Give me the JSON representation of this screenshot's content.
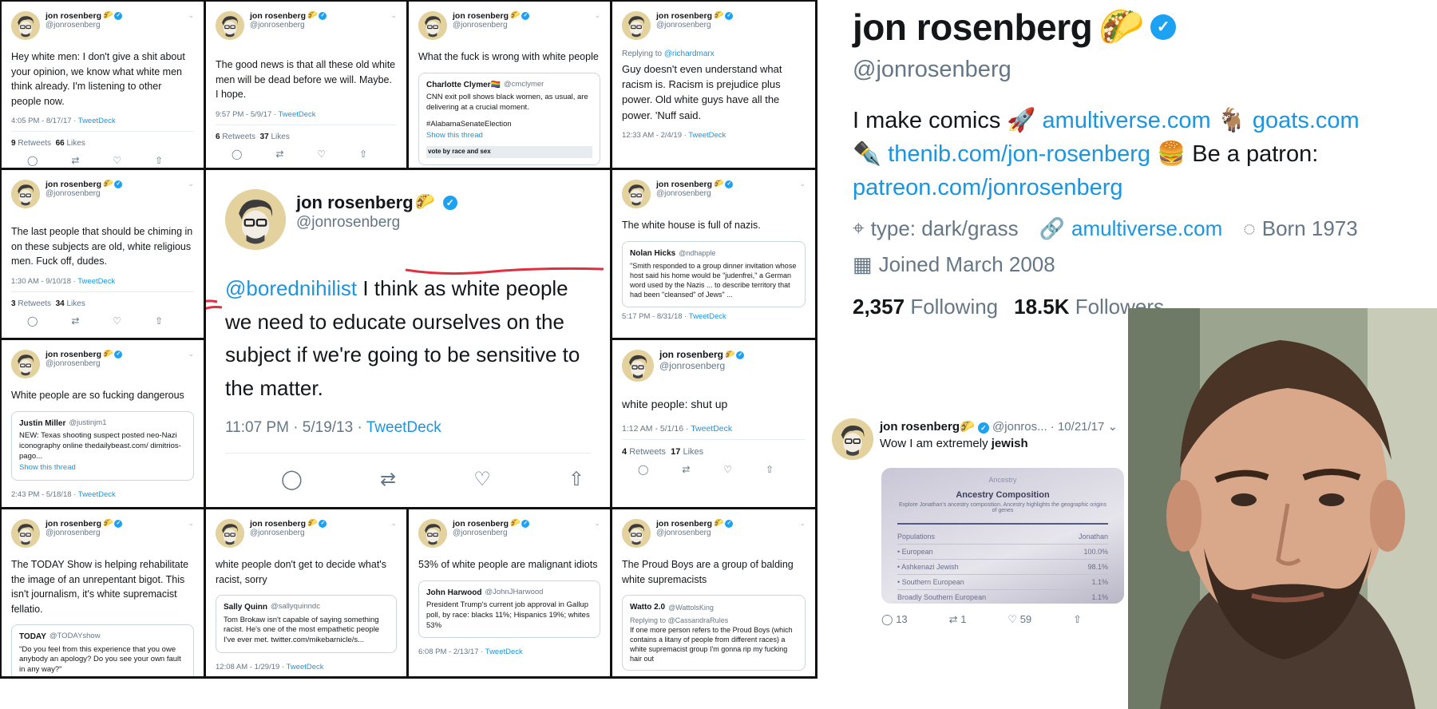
{
  "account": {
    "name": "jon rosenberg",
    "handle": "@jonrosenberg",
    "taco": "🌮",
    "verified_mark": "✓",
    "chevron": "⌄",
    "show_thread": "Show this thread",
    "action_icons": [
      "reply-icon",
      "retweet-icon",
      "like-icon",
      "share-icon"
    ],
    "action_glyphs": [
      "◯",
      "⇄",
      "♡",
      "⇧"
    ]
  },
  "tweets": {
    "t1": {
      "body": "Hey white men: I don't give a shit about your opinion, we know what white men think already. I'm listening to other people now.",
      "time": "4:05 PM - 8/17/17 · ",
      "source": "TweetDeck",
      "rt": "9",
      "rt_label": "Retweets",
      "likes": "66",
      "likes_label": "Likes"
    },
    "t2": {
      "body": "The good news is that all these old white men will be dead before we will. Maybe. I hope.",
      "time": "9:57 PM - 5/9/17 · ",
      "source": "TweetDeck",
      "rt": "6",
      "rt_label": "Retweets",
      "likes": "37",
      "likes_label": "Likes"
    },
    "t3": {
      "body": "What the fuck is wrong with white people",
      "quote_name": "Charlotte Clymer🏳️‍🌈",
      "quote_handle": "@cmclymer",
      "quote_text": "CNN exit poll shows black women, as usual, are delivering at a crucial moment.",
      "quote_tag": "#AlabamaSenateElection",
      "quote_cut": "vote by race and sex"
    },
    "t4": {
      "replying_prefix": "Replying to ",
      "replying_to": "@richardmarx",
      "body": "Guy doesn't even understand what racism is. Racism is prejudice plus power. Old white guys have all the power. 'Nuff said.",
      "time": "12:33 AM - 2/4/19 · ",
      "source": "TweetDeck"
    },
    "t5": {
      "body": "The last people that should be chiming in on these subjects are old, white religious men. Fuck off, dudes.",
      "time": "1:30 AM - 9/10/18 · ",
      "source": "TweetDeck",
      "rt": "3",
      "rt_label": "Retweets",
      "likes": "34",
      "likes_label": "Likes"
    },
    "t6": {
      "mention": "@borednihilist",
      "body": " I think as white people we need to educate ourselves on the subject if we're going to be sensitive to the matter.",
      "time": "11:07 PM · 5/19/13 · ",
      "source": "TweetDeck"
    },
    "t7": {
      "body": "The white house is full of nazis.",
      "quote_name": "Nolan Hicks",
      "quote_handle": "@ndhapple",
      "quote_text": "\"Smith responded to a group dinner invitation whose host said his home would be \"judenfrei,\" a German word used by the Nazis ... to describe territory that had been \"cleansed\" of Jews\" ...",
      "time": "5:17 PM - 8/31/18 · ",
      "source": "TweetDeck"
    },
    "t8": {
      "body": "White people are so fucking dangerous",
      "quote_name": "Justin Miller",
      "quote_handle": "@justinjm1",
      "quote_text": "NEW: Texas shooting suspect posted neo-Nazi iconography online thedailybeast.com/ dimitrios-pago...",
      "time": "2:43 PM - 5/18/18 · ",
      "source": "TweetDeck"
    },
    "t9": {
      "body": "white people: shut up",
      "time": "1:12 AM - 5/1/16 · ",
      "source": "TweetDeck",
      "rt": "4",
      "rt_label": "Retweets",
      "likes": "17",
      "likes_label": "Likes"
    },
    "t10": {
      "body": "The TODAY Show is helping rehabilitate the image of an unrepentant bigot. This isn't journalism, it's white supremacist fellatio.",
      "quote_name": "TODAY",
      "quote_handle": "@TODAYshow",
      "quote_text": "\"Do you feel from this experience that you owe anybody an apology? Do you see your own fault in any way?\""
    },
    "t11": {
      "body": "white people don't get to decide what's racist, sorry",
      "quote_name": "Sally Quinn",
      "quote_handle": "@sallyquinndc",
      "quote_text": "Tom Brokaw isn't capable of saying something racist. He's one of the most empathetic people I've ever met. twitter.com/mikebarnicle/s...",
      "time": "12:08 AM - 1/29/19 · ",
      "source": "TweetDeck"
    },
    "t12": {
      "body": "53% of white people are malignant idiots",
      "quote_name": "John Harwood",
      "quote_handle": "@JohnJHarwood",
      "quote_text": "President Trump's current job approval in Gallup poll, by race: blacks 11%; Hispanics 19%; whites 53%",
      "time": "6:08 PM - 2/13/17 · ",
      "source": "TweetDeck"
    },
    "t13": {
      "body": "The Proud Boys are a group of balding white supremacists",
      "quote_name": "Watto 2.0",
      "quote_handle": "@WattolsKing",
      "quote_reply": "Replying to @CassandraRules",
      "quote_text": "If one more person refers to the Proud Boys (which contains a litany of people from different races) a white supremacist group I'm gonna rip my fucking hair out"
    }
  },
  "profile": {
    "name": "jon rosenberg",
    "taco": "🌮",
    "verified_mark": "✓",
    "handle": "@jonrosenberg",
    "bio_1": "I make comics 🚀 ",
    "bio_link_1": "amultiverse.com",
    "bio_2": " 🐐 ",
    "bio_link_2": "goats.com",
    "bio_3": "✒️ ",
    "bio_link_3": "thenib.com/jon-rosenberg",
    "bio_4": " 🍔 Be a patron:",
    "bio_link_4": "patreon.com/jonrosenberg",
    "location_icon": "⌖",
    "location": "type: dark/grass",
    "link_icon": "🔗",
    "link": "amultiverse.com",
    "birth_icon": "◌",
    "born": "Born 1973",
    "joined_icon": "▦",
    "joined": "Joined March 2008",
    "following_count": "2,357",
    "following_label": "Following",
    "followers_count": "18.5K",
    "followers_label": "Followers"
  },
  "small_tweet": {
    "name": "jon rosenberg",
    "taco": "🌮",
    "meta": "@jonros... · 10/21/17",
    "text_prefix": "Wow I am extremely ",
    "text_bold": "jewish",
    "img_header": "Ancestry",
    "img_title": "Ancestry Composition",
    "img_sub": "Explore Jonathan's ancestry composition. Ancestry highlights the geographic origins of genes",
    "img_col1": "Populations",
    "img_col2": "Jonathan",
    "img_rows": [
      {
        "label": "• European",
        "value": "100.0%"
      },
      {
        "label": "• Ashkenazi Jewish",
        "value": "98.1%"
      },
      {
        "label": "• Southern European",
        "value": "1.1%"
      },
      {
        "label": "Broadly Southern European",
        "value": "1.1%"
      }
    ],
    "replies": "13",
    "retweets": "1",
    "likes": "59"
  }
}
